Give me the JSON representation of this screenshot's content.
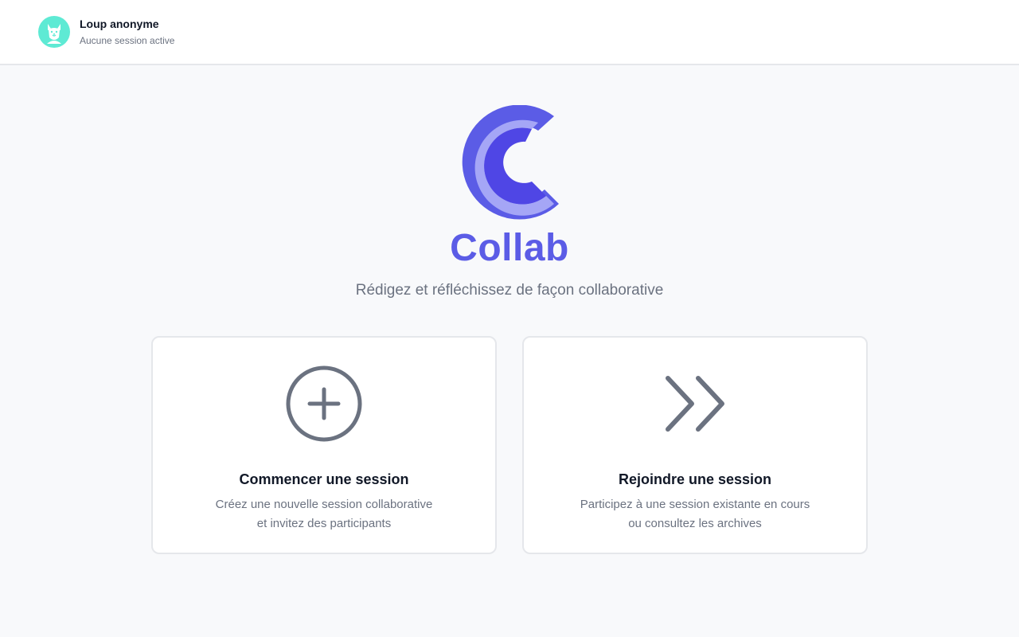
{
  "user": {
    "name": "Loup anonyme",
    "status": "Aucune session active",
    "avatar_icon": "wolf-icon",
    "avatar_color": "#5eead4"
  },
  "brand": {
    "name": "Collab",
    "tagline": "Rédigez et réfléchissez de façon collaborative",
    "logo_icon": "collab-c-logo",
    "color": "#5b5ce6"
  },
  "cards": [
    {
      "icon": "plus-circle-icon",
      "title": "Commencer une session",
      "description_line1": "Créez une nouvelle session collaborative",
      "description_line2": "et invitez des participants"
    },
    {
      "icon": "double-chevron-right-icon",
      "title": "Rejoindre une session",
      "description_line1": "Participez à une session existante en cours",
      "description_line2": "ou consultez les archives"
    }
  ]
}
